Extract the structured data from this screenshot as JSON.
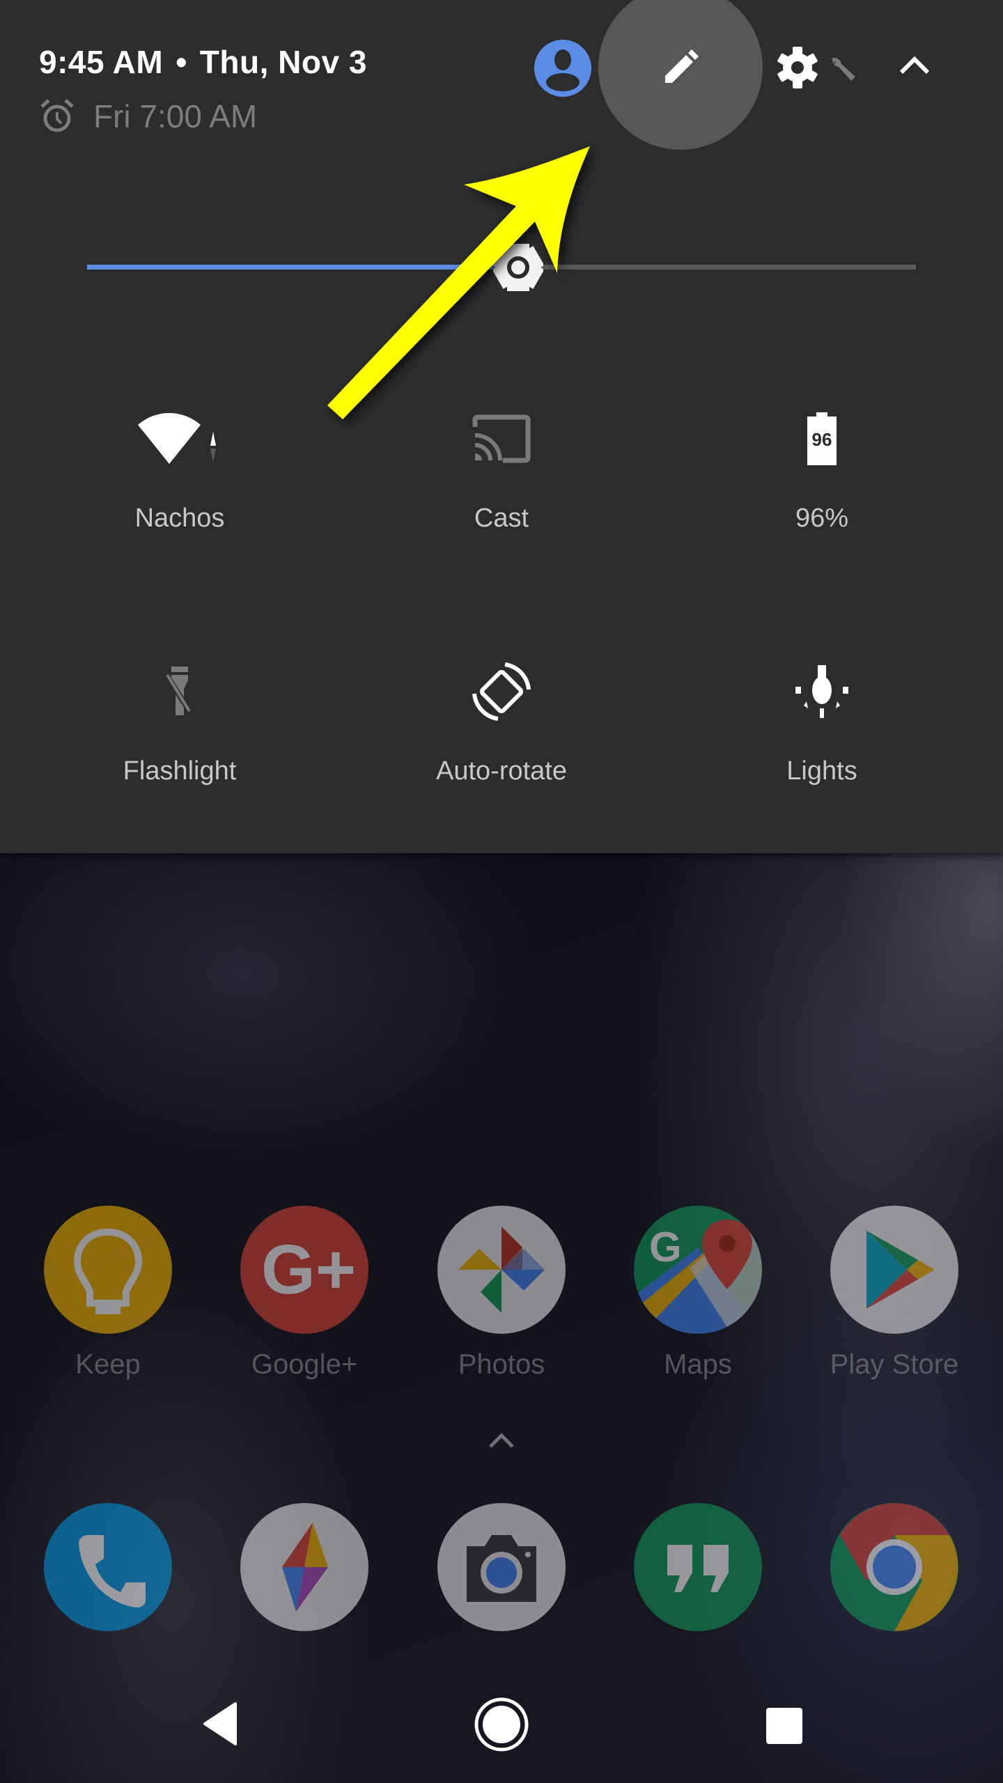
{
  "status_header": {
    "time": "9:45 AM",
    "separator": "•",
    "date": "Thu, Nov 3",
    "alarm_text": "Fri 7:00 AM",
    "icons": [
      "alarm-clock-icon",
      "user-avatar-icon",
      "edit-pencil-icon",
      "settings-gear-icon",
      "wrench-icon",
      "chevron-up-icon"
    ]
  },
  "brightness": {
    "level_percent": 52,
    "accent_color": "#5b8de6"
  },
  "quick_tiles": [
    {
      "label": "Nachos",
      "icon": "wifi-icon",
      "active": true
    },
    {
      "label": "Cast",
      "icon": "cast-icon",
      "active": false
    },
    {
      "label": "96%",
      "icon": "battery-icon",
      "battery_text": "96",
      "active": true
    },
    {
      "label": "Flashlight",
      "icon": "flashlight-off-icon",
      "active": false
    },
    {
      "label": "Auto-rotate",
      "icon": "auto-rotate-icon",
      "active": true
    },
    {
      "label": "Lights",
      "icon": "light-bulb-icon",
      "active": true
    }
  ],
  "home_apps": [
    {
      "label": "Keep",
      "icon": "keep-icon",
      "color": "#f6b400"
    },
    {
      "label": "Google+",
      "icon": "google-plus-icon",
      "color": "#db4437"
    },
    {
      "label": "Photos",
      "icon": "photos-icon",
      "color": "#f1f1f1"
    },
    {
      "label": "Maps",
      "icon": "maps-icon",
      "color": "#0f9d58"
    },
    {
      "label": "Play Store",
      "icon": "play-store-icon",
      "color": "#f1f1f1"
    }
  ],
  "dock_apps": [
    {
      "name": "Phone",
      "icon": "phone-icon",
      "color": "#039be5"
    },
    {
      "name": "Compass app",
      "icon": "compass-app-icon",
      "color": "#eeeeee"
    },
    {
      "name": "Camera",
      "icon": "camera-icon",
      "color": "#eeeeee"
    },
    {
      "name": "Hangouts",
      "icon": "hangouts-icon",
      "color": "#0f9d58"
    },
    {
      "name": "Chrome",
      "icon": "chrome-icon",
      "color": "#db4437"
    }
  ],
  "annotation": {
    "arrow_color": "#ffff00",
    "points_to": "edit-button"
  },
  "nav_bar": [
    "back-icon",
    "home-icon",
    "recents-icon"
  ]
}
